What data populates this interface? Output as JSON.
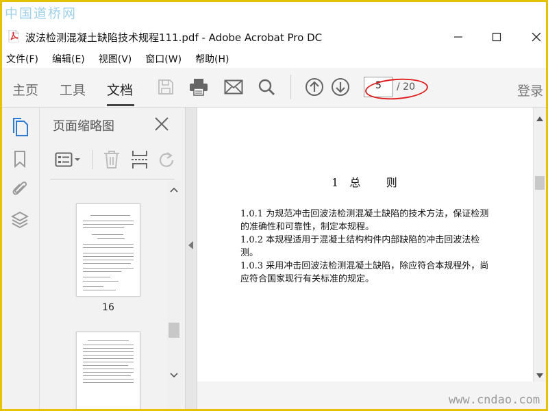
{
  "watermark": {
    "top": "中国道桥网",
    "bottom": "www.cndao.com"
  },
  "window": {
    "title": "波法检测混凝土缺陷技术规程111.pdf - Adobe Acrobat Pro DC"
  },
  "menu": {
    "items": [
      "文件(F)",
      "编辑(E)",
      "视图(V)",
      "窗口(W)",
      "帮助(H)"
    ]
  },
  "toolbar": {
    "tabs": [
      "主页",
      "工具",
      "文档"
    ],
    "active_tab": "文档",
    "current_page": "5",
    "total_pages": "/ 20",
    "login": "登录"
  },
  "thumbnails_pane": {
    "title": "页面缩略图",
    "visible_page_label": "16"
  },
  "document": {
    "heading": "1  总     则",
    "paragraphs": [
      "1.0.1   为规范冲击回波法检测混凝土缺陷的技术方法，保证检测的准确性和可靠性，制定本规程。",
      "1.0.2   本规程适用于混凝土结构构件内部缺陷的冲击回波法检测。",
      "1.0.3   采用冲击回波法检测混凝土缺陷，除应符合本规程外，尚应符合国家现行有关标准的规定。"
    ]
  },
  "colors": {
    "accent": "#2b7bd6",
    "annotation": "#e02020",
    "pdf_red": "#d8232a"
  }
}
